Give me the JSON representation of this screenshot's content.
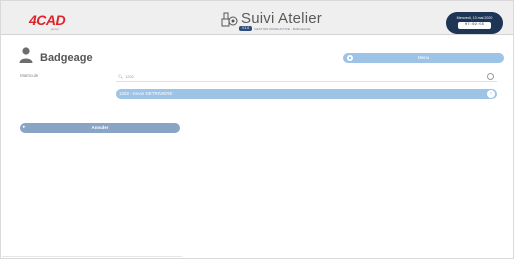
{
  "header": {
    "logo": "4CAD",
    "logo_sub": "group",
    "app_title": "Suivi Atelier",
    "app_tag": "V1.0",
    "app_subtitle": "GESTION PRODUCTIVE - BADGEAGE",
    "date_text": "Mercredi, 13 mai 2020",
    "time_text": "07:02:55",
    "icons": [
      "workshop-icon"
    ]
  },
  "badgeage": {
    "title": "Badgeage",
    "menu_label": "Menu",
    "field_label": "Matricule",
    "search_value": "1202",
    "result_label": "1202 - Kevin DETRIVIERE",
    "cancel_label": "Annuler"
  },
  "colors": {
    "accent": "#9dc3e6",
    "header_bg": "#efefef",
    "date_bg": "#1e3556",
    "cancel_bg": "#8aa4c6",
    "logo": "#e0232a"
  }
}
